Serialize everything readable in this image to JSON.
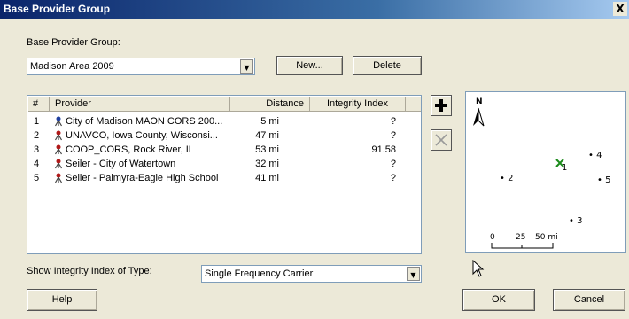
{
  "window": {
    "title": "Base Provider Group",
    "close_label": "X"
  },
  "group": {
    "label": "Base Provider Group:",
    "selected": "Madison Area 2009",
    "new_label": "New...",
    "delete_label": "Delete"
  },
  "table": {
    "headers": [
      "#",
      "Provider",
      "Distance",
      "Integrity Index"
    ],
    "rows": [
      {
        "num": "1",
        "provider": "City of Madison MAON CORS 200...",
        "distance": "5 mi",
        "index": "?"
      },
      {
        "num": "2",
        "provider": "UNAVCO, Iowa County, Wisconsi...",
        "distance": "47 mi",
        "index": "?"
      },
      {
        "num": "3",
        "provider": "COOP_CORS, Rock River, IL",
        "distance": "53 mi",
        "index": "91.58"
      },
      {
        "num": "4",
        "provider": "Seiler - City of Watertown",
        "distance": "32 mi",
        "index": "?"
      },
      {
        "num": "5",
        "provider": "Seiler - Palmyra-Eagle High School",
        "distance": "41 mi",
        "index": "?"
      }
    ]
  },
  "map": {
    "north_label": "N",
    "markers": [
      {
        "label": "1",
        "type": "station-selected"
      },
      {
        "label": "2",
        "type": "station"
      },
      {
        "label": "3",
        "type": "station"
      },
      {
        "label": "4",
        "type": "station"
      },
      {
        "label": "5",
        "type": "station"
      }
    ],
    "scale": {
      "ticks": [
        "0",
        "25",
        "50 mi"
      ]
    },
    "colors": {
      "selected_marker": "#1a8a1a"
    }
  },
  "integrity": {
    "label": "Show Integrity Index of Type:",
    "selected": "Single Frequency Carrier"
  },
  "buttons": {
    "help": "Help",
    "ok": "OK",
    "cancel": "Cancel"
  }
}
